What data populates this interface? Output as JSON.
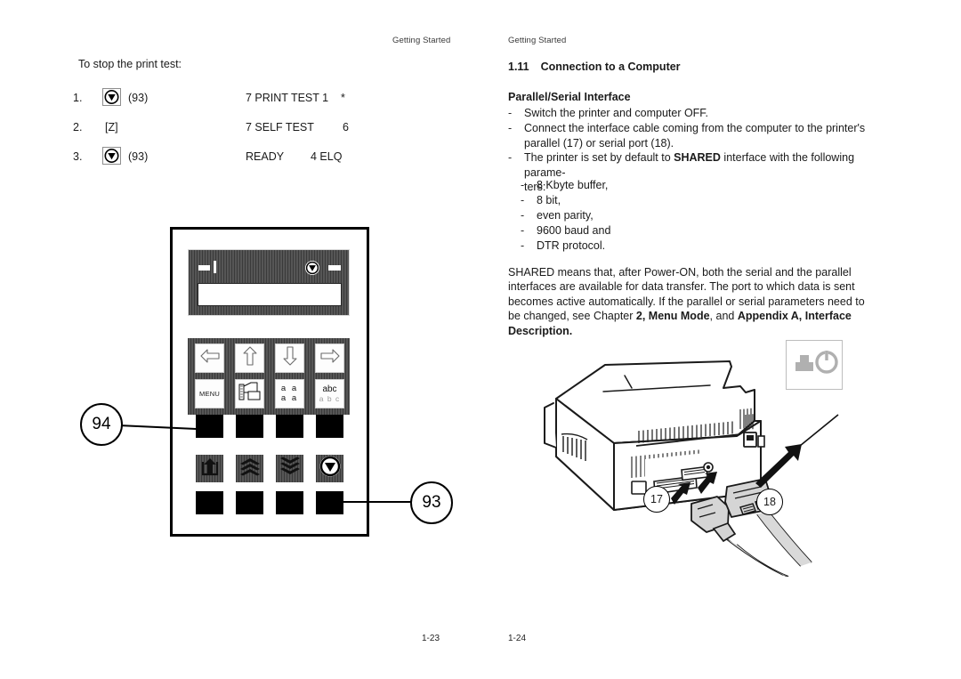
{
  "document": {
    "header_left": "Getting Started",
    "header_right": "Getting Started",
    "footer_left": "1-23",
    "footer_right": "1-24"
  },
  "left_page": {
    "intro": "To stop the print test:",
    "steps": [
      {
        "number": "1.",
        "key_icon": "stop-icon",
        "key_text": "",
        "key_ref": "(93)",
        "display": "7 PRINT TEST 1",
        "display_right": "*"
      },
      {
        "number": "2.",
        "key_icon": "",
        "key_text": "[Z]",
        "key_ref": "",
        "display": "7 SELF TEST",
        "display_right": "6"
      },
      {
        "number": "3.",
        "key_icon": "stop-icon",
        "key_text": "",
        "key_ref": "(93)",
        "display": "READY",
        "display_right": "4 ELQ"
      }
    ],
    "control_panel": {
      "keys_row1": [
        {
          "icon": "arrow-left-icon",
          "label": ""
        },
        {
          "icon": "arrow-up-icon",
          "label": ""
        },
        {
          "icon": "arrow-down-icon",
          "label": ""
        },
        {
          "icon": "arrow-right-icon",
          "label": ""
        }
      ],
      "keys_row2": [
        {
          "icon": "",
          "label": "MENU"
        },
        {
          "icon": "paper-path-icon",
          "label": ""
        },
        {
          "icon": "font-size-icon",
          "label_top": "a a",
          "label_bottom": "a a"
        },
        {
          "icon": "character-set-icon",
          "label_top": "abc",
          "label_bottom": "a b c"
        }
      ],
      "keys_row3": [
        {
          "icon": "paper-load-up-icon",
          "label": ""
        },
        {
          "icon": "form-feed-up-icon",
          "label": ""
        },
        {
          "icon": "form-feed-down-icon",
          "label": ""
        },
        {
          "icon": "stop-icon",
          "label": ""
        }
      ],
      "indicators": [
        {
          "icon": "led-indicator",
          "label": ""
        },
        {
          "icon": "led-bar-indicator",
          "label": ""
        },
        {
          "icon": "stop-indicator-icon",
          "label": ""
        },
        {
          "icon": "led-indicator",
          "label": ""
        }
      ],
      "lcd_text": ""
    },
    "callouts": [
      {
        "id": "94",
        "label": "94"
      },
      {
        "id": "93",
        "label": "93"
      }
    ]
  },
  "right_page": {
    "section_number": "1.11",
    "section_title": "Connection to a Computer",
    "subsection_title": "Parallel/Serial Interface",
    "bullets": [
      "Switch the printer and computer OFF.",
      "Connect the interface cable coming from the computer to the printer's parallel (17) or serial port (18).",
      "The printer is set by default to SHARED interface with the following parameters:"
    ],
    "bullet_3_pre": "The printer is set by default to ",
    "bullet_3_bold": "SHARED",
    "bullet_3_post": " interface with the following parame-",
    "bullet_3_cont": "ters:",
    "sub_bullets": [
      "8 Kbyte buffer,",
      "8 bit,",
      "even parity,",
      "9600 baud and",
      "DTR protocol."
    ],
    "paragraph": {
      "line1": "SHARED means that, after Power-ON, both the serial and the parallel interfaces",
      "line2": "are available for data transfer. The port to which data is sent becomes active",
      "line3": "automatically. If the parallel or serial parameters need to be changed, see",
      "line4_pre": "Chapter ",
      "line4_b1": "2, Menu Mode",
      "line4_mid": ", and ",
      "line4_b2": "Appendix A, Interface Description."
    },
    "illustration": {
      "name": "printer-rear-view",
      "power_switch_icon": "power-switch-icon",
      "callouts": [
        {
          "id": "17",
          "label": "17",
          "meaning": "parallel port connector"
        },
        {
          "id": "18",
          "label": "18",
          "meaning": "serial port connector"
        }
      ]
    }
  },
  "colors": {
    "panel_dark": "#4b4b4b",
    "panel_stripe": "#3a3a3a",
    "key_face": "#fdfdfd",
    "pad_black": "#000000",
    "ink": "#1a1a1a",
    "power_icon_gray": "#b0b0b0"
  }
}
